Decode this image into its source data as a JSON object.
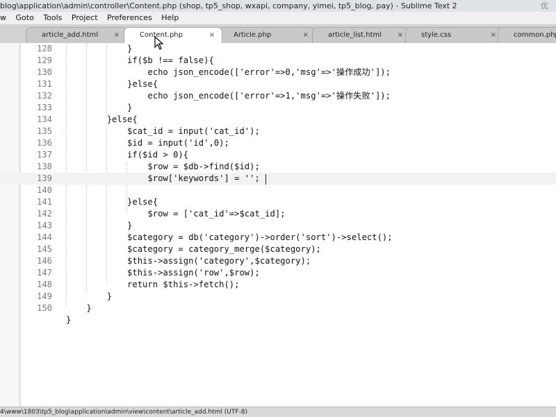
{
  "window": {
    "title": "blog\\application\\admin\\controller\\Content.php (shop, tp5_shop, wxapi, company, yimei, tp5_blog, pay) - Sublime Text 2",
    "watermark": "优"
  },
  "menu": [
    "w",
    "Goto",
    "Tools",
    "Project",
    "Preferences",
    "Help"
  ],
  "tabs": [
    {
      "label": "article_add.html",
      "close": "×",
      "active": false
    },
    {
      "label": "Content.php",
      "close": "×",
      "active": true
    },
    {
      "label": "Article.php",
      "close": "×",
      "active": false
    },
    {
      "label": "article_list.html",
      "close": "×",
      "active": false
    },
    {
      "label": "style.css",
      "close": "×",
      "active": false
    },
    {
      "label": "common.php",
      "close": "×",
      "active": false
    }
  ],
  "editor": {
    "current_line": 139,
    "lines": [
      {
        "num": "128",
        "text": "            }"
      },
      {
        "num": "129",
        "text": "            if($b !== false){"
      },
      {
        "num": "130",
        "text": "                echo json_encode(['error'=>0,'msg'=>'操作成功']);"
      },
      {
        "num": "131",
        "text": "            }else{"
      },
      {
        "num": "132",
        "text": "                echo json_encode(['error'=>1,'msg'=>'操作失败']);"
      },
      {
        "num": "133",
        "text": "            }"
      },
      {
        "num": "134",
        "text": "        }else{"
      },
      {
        "num": "135",
        "text": "            $cat_id = input('cat_id');"
      },
      {
        "num": "136",
        "text": "            $id = input('id',0);"
      },
      {
        "num": "137",
        "text": "            if($id > 0){"
      },
      {
        "num": "138",
        "text": "                $row = $db->find($id);"
      },
      {
        "num": "139",
        "text": "                $row['keywords'] = '';"
      },
      {
        "num": "140",
        "text": ""
      },
      {
        "num": "141",
        "text": "            }else{"
      },
      {
        "num": "142",
        "text": "                $row = ['cat_id'=>$cat_id];"
      },
      {
        "num": "143",
        "text": "            }"
      },
      {
        "num": "144",
        "text": "            $category = db('category')->order('sort')->select();"
      },
      {
        "num": "145",
        "text": "            $category = category_merge($category);"
      },
      {
        "num": "146",
        "text": "            $this->assign('category',$category);"
      },
      {
        "num": "147",
        "text": "            $this->assign('row',$row);"
      },
      {
        "num": "148",
        "text": "            return $this->fetch();"
      },
      {
        "num": "149",
        "text": "        }"
      },
      {
        "num": "150",
        "text": "    }"
      },
      {
        "num": "",
        "text": "}"
      }
    ]
  },
  "status": {
    "text": "4\\www\\1803\\tp5_blog\\application\\admin\\view\\content\\article_add.html (UTF-8)"
  }
}
